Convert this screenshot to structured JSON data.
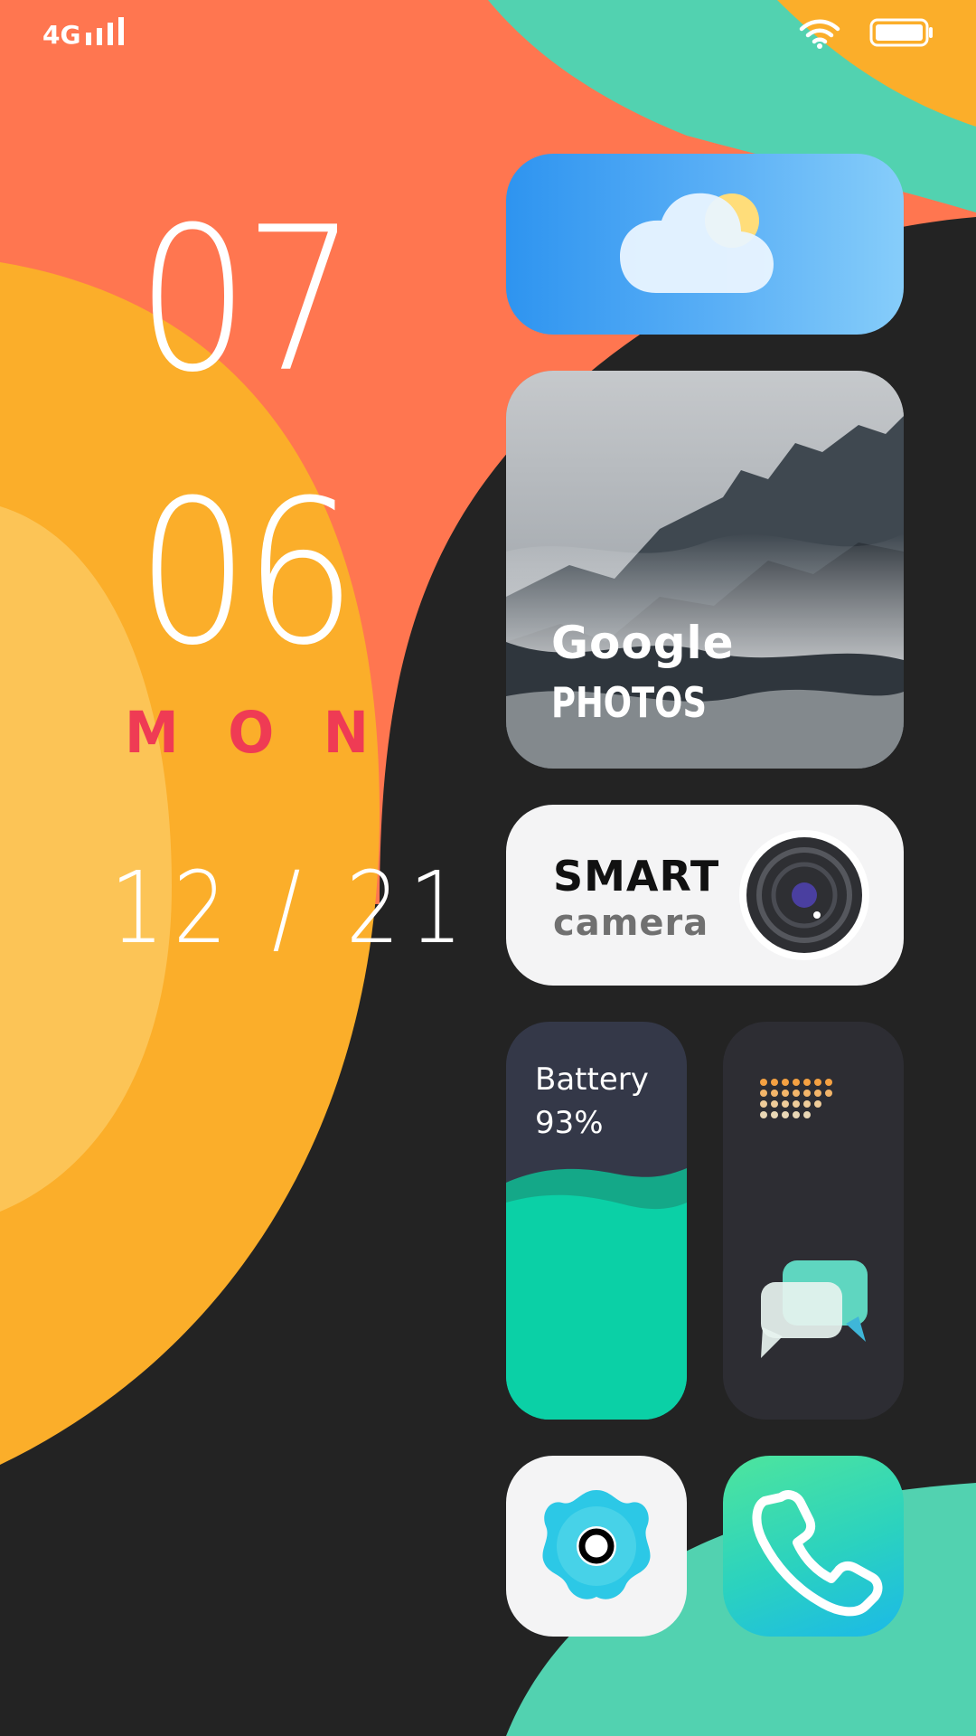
{
  "status_bar": {
    "network": "4G",
    "signal_icon": "signal-bars-icon",
    "wifi_icon": "wifi-icon",
    "battery_icon": "battery-full-icon"
  },
  "clock": {
    "hour": "07",
    "minute": "06",
    "weekday_letters": [
      "M",
      "O",
      "N"
    ],
    "date": "12 / 21"
  },
  "widgets": {
    "weather": {
      "icon": "cloud-sun-icon"
    },
    "photos": {
      "line1": "Google",
      "line2": "PHOTOS"
    },
    "camera": {
      "line1": "SMART",
      "line2": "camera",
      "icon": "camera-lens-icon"
    },
    "battery": {
      "label": "Battery",
      "percent_text": "93%",
      "level": 0.93
    },
    "messages": {
      "icon": "chat-bubbles-icon"
    },
    "app_shortcut": {
      "icon": "flower-camera-icon"
    },
    "phone": {
      "icon": "phone-handset-icon"
    }
  },
  "colors": {
    "coral": "#ff7650",
    "orange": "#fbae2a",
    "light_orange": "#fcc456",
    "teal": "#52d2b0",
    "dark": "#232323",
    "weekday_red": "#ef3b54"
  }
}
